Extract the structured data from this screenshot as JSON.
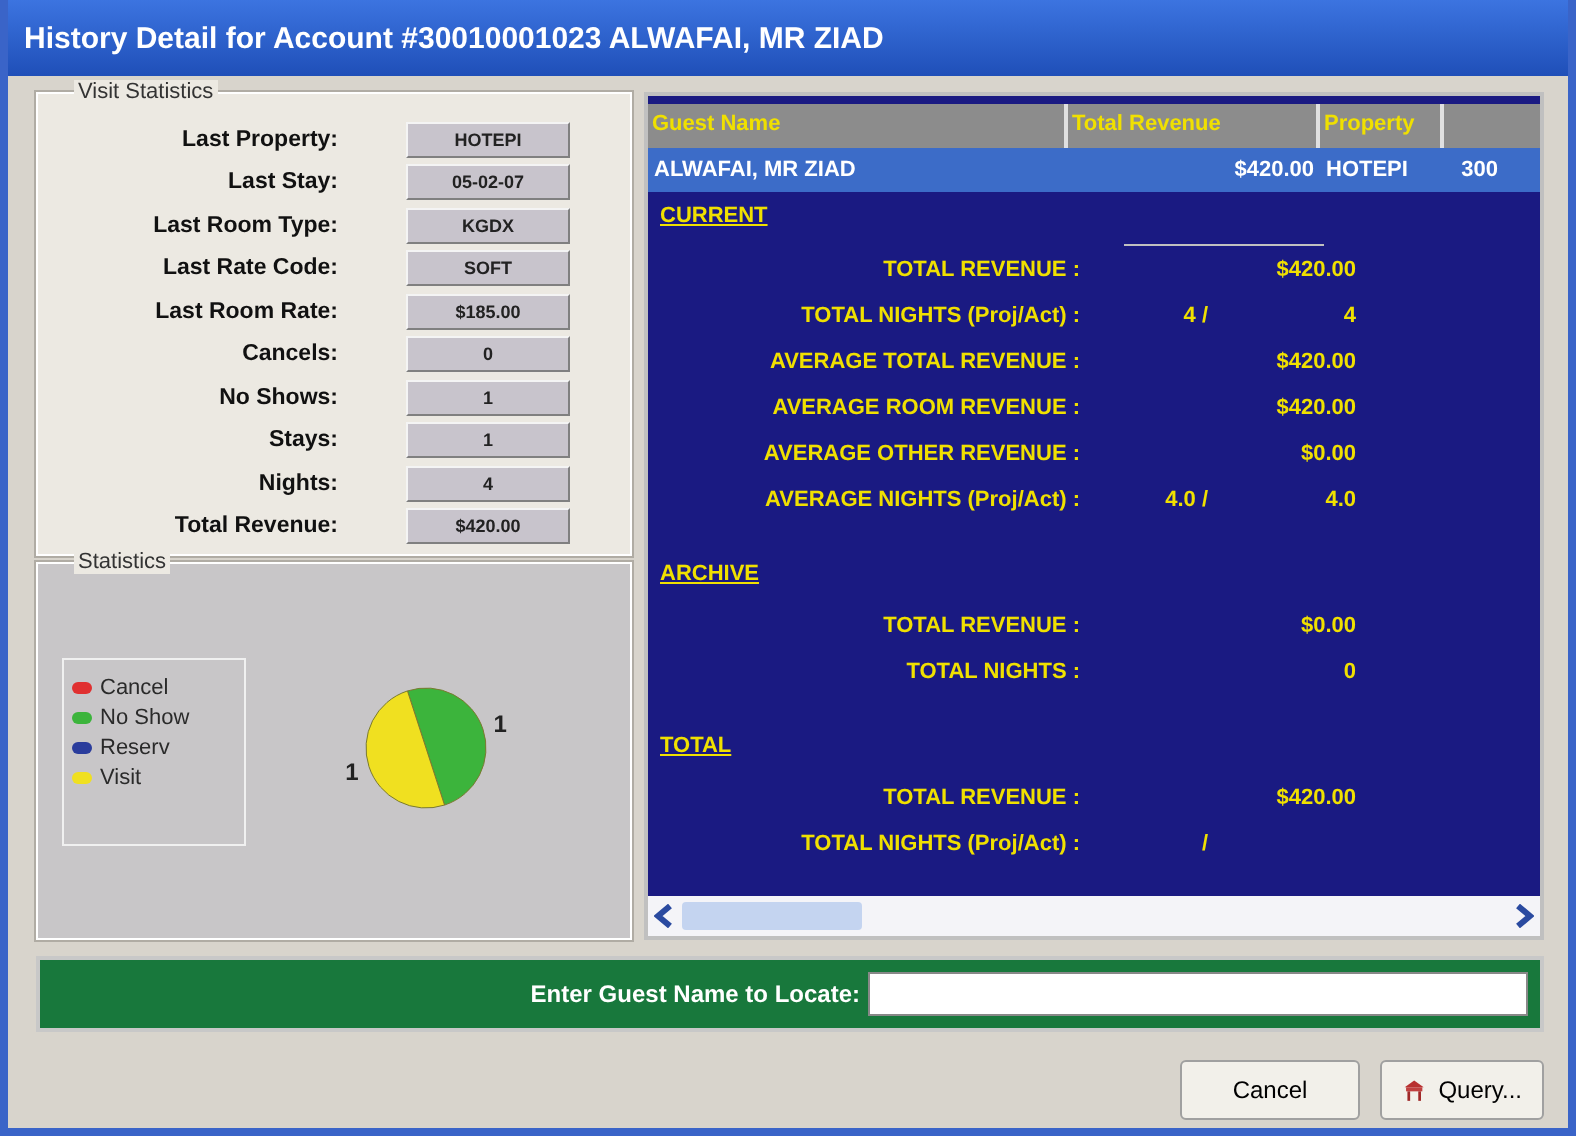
{
  "window": {
    "title": "History Detail for Account #30010001023 ALWAFAI, MR ZIAD"
  },
  "visit_statistics": {
    "title": "Visit Statistics",
    "fields": [
      {
        "label": "Last Property:",
        "value": "HOTEPI"
      },
      {
        "label": "Last Stay:",
        "value": "05-02-07"
      },
      {
        "label": "Last Room Type:",
        "value": "KGDX"
      },
      {
        "label": "Last Rate Code:",
        "value": "SOFT"
      },
      {
        "label": "Last Room Rate:",
        "value": "$185.00"
      },
      {
        "label": "Cancels:",
        "value": "0"
      },
      {
        "label": "No Shows:",
        "value": "1"
      },
      {
        "label": "Stays:",
        "value": "1"
      },
      {
        "label": "Nights:",
        "value": "4"
      },
      {
        "label": "Total Revenue:",
        "value": "$420.00"
      }
    ]
  },
  "statistics": {
    "title": "Statistics",
    "legend": [
      {
        "color": "#e03030"
      },
      {
        "color": "#3cb43c"
      },
      {
        "color": "#2a3c9c"
      },
      {
        "color": "#f0e020"
      }
    ],
    "chart_data": {
      "type": "pie",
      "categories": [
        "Cancel",
        "No Show",
        "Reserv",
        "Visit"
      ],
      "values": [
        0,
        1,
        0,
        1
      ],
      "data_labels": true
    }
  },
  "guest_table": {
    "columns": [
      "Guest Name",
      "Total Revenue",
      "Property"
    ],
    "rows": [
      {
        "cells": [
          "ALWAFAI, MR ZIAD",
          "$420.00",
          "HOTEPI",
          "300"
        ],
        "selected": true
      }
    ]
  },
  "sections": [
    {
      "heading": "CURRENT",
      "rows": [
        {
          "label": "TOTAL REVENUE :",
          "value": "$420.00"
        },
        {
          "label": "TOTAL NIGHTS (Proj/Act) :",
          "proj": "4 /",
          "value": "4"
        },
        {
          "label": "AVERAGE TOTAL REVENUE :",
          "value": "$420.00"
        },
        {
          "label": "AVERAGE ROOM REVENUE :",
          "value": "$420.00"
        },
        {
          "label": "AVERAGE OTHER REVENUE :",
          "value": "$0.00"
        },
        {
          "label": "AVERAGE NIGHTS (Proj/Act) :",
          "proj": "4.0 /",
          "value": "4.0"
        }
      ]
    },
    {
      "heading": "ARCHIVE",
      "rows": [
        {
          "label": "TOTAL REVENUE :",
          "value": "$0.00"
        },
        {
          "label": "TOTAL NIGHTS :",
          "value": "0"
        }
      ]
    },
    {
      "heading": "TOTAL",
      "rows": [
        {
          "label": "TOTAL REVENUE :",
          "value": "$420.00"
        },
        {
          "label": "TOTAL NIGHTS (Proj/Act) :",
          "proj": "/"
        }
      ]
    }
  ],
  "locate": {
    "label": "Enter Guest Name to Locate:"
  },
  "buttons": [
    {
      "label": "Cancel",
      "kind": "plain"
    },
    {
      "label": "Query...",
      "kind": "query"
    }
  ]
}
